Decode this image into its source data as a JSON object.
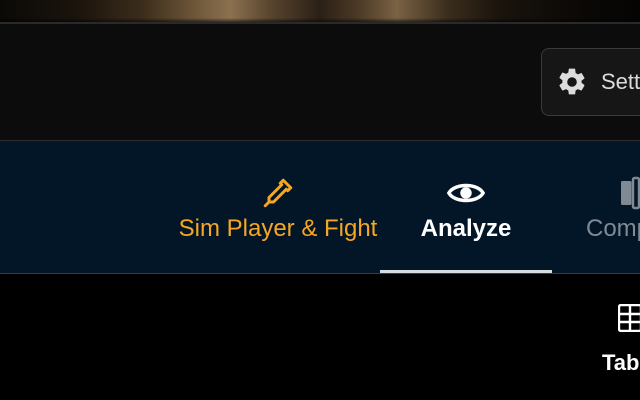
{
  "toolbar": {
    "settings_label": "Settings",
    "settings_icon": "gear-icon"
  },
  "tabs": [
    {
      "label": "Sim Player & Fight",
      "icon": "eyedropper-icon",
      "color": "#f5a623",
      "active": false
    },
    {
      "label": "Analyze",
      "icon": "eye-icon",
      "color": "#ffffff",
      "active": true
    },
    {
      "label": "Compare",
      "icon": "compare-icon",
      "color": "#7f8a94",
      "active": false
    }
  ],
  "view_toggle": {
    "label": "Table",
    "icon": "table-icon"
  },
  "colors": {
    "accent": "#f5a623",
    "tabbar_bg": "#031628",
    "active_underline": "#d8dde2"
  }
}
